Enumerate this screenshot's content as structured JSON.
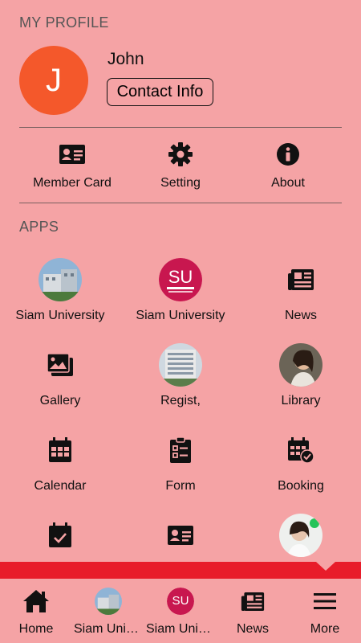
{
  "profile": {
    "section_title": "MY PROFILE",
    "avatar_initial": "J",
    "avatar_color": "#f4582b",
    "name": "John",
    "contact_label": "Contact Info"
  },
  "quick_actions": [
    {
      "label": "Member Card",
      "icon": "id-card-icon"
    },
    {
      "label": "Setting",
      "icon": "gear-icon"
    },
    {
      "label": "About",
      "icon": "info-icon"
    }
  ],
  "apps": {
    "section_title": "APPS",
    "items": [
      {
        "label": "Siam University",
        "icon": "campus-photo"
      },
      {
        "label": "Siam University",
        "icon": "su-logo"
      },
      {
        "label": "News",
        "icon": "newspaper-icon"
      },
      {
        "label": "Gallery",
        "icon": "images-icon"
      },
      {
        "label": "Regist,",
        "icon": "building-photo"
      },
      {
        "label": "Library",
        "icon": "library-photo"
      },
      {
        "label": "Calendar",
        "icon": "calendar-icon"
      },
      {
        "label": "Form",
        "icon": "clipboard-icon"
      },
      {
        "label": "Booking",
        "icon": "calendar-check-icon"
      },
      {
        "label": "",
        "icon": "calendar-check-icon"
      },
      {
        "label": "",
        "icon": "id-card-icon"
      },
      {
        "label": "",
        "icon": "contact-photo"
      }
    ]
  },
  "bottom_nav": [
    {
      "label": "Home",
      "icon": "home-icon"
    },
    {
      "label": "Siam University",
      "icon": "campus-photo"
    },
    {
      "label": "Siam University",
      "icon": "su-logo"
    },
    {
      "label": "News",
      "icon": "newspaper-icon"
    },
    {
      "label": "More",
      "icon": "menu-icon"
    }
  ],
  "colors": {
    "background": "#f5a3a5",
    "accent_bar": "#e81c2a",
    "su_logo": "#c8174f"
  }
}
